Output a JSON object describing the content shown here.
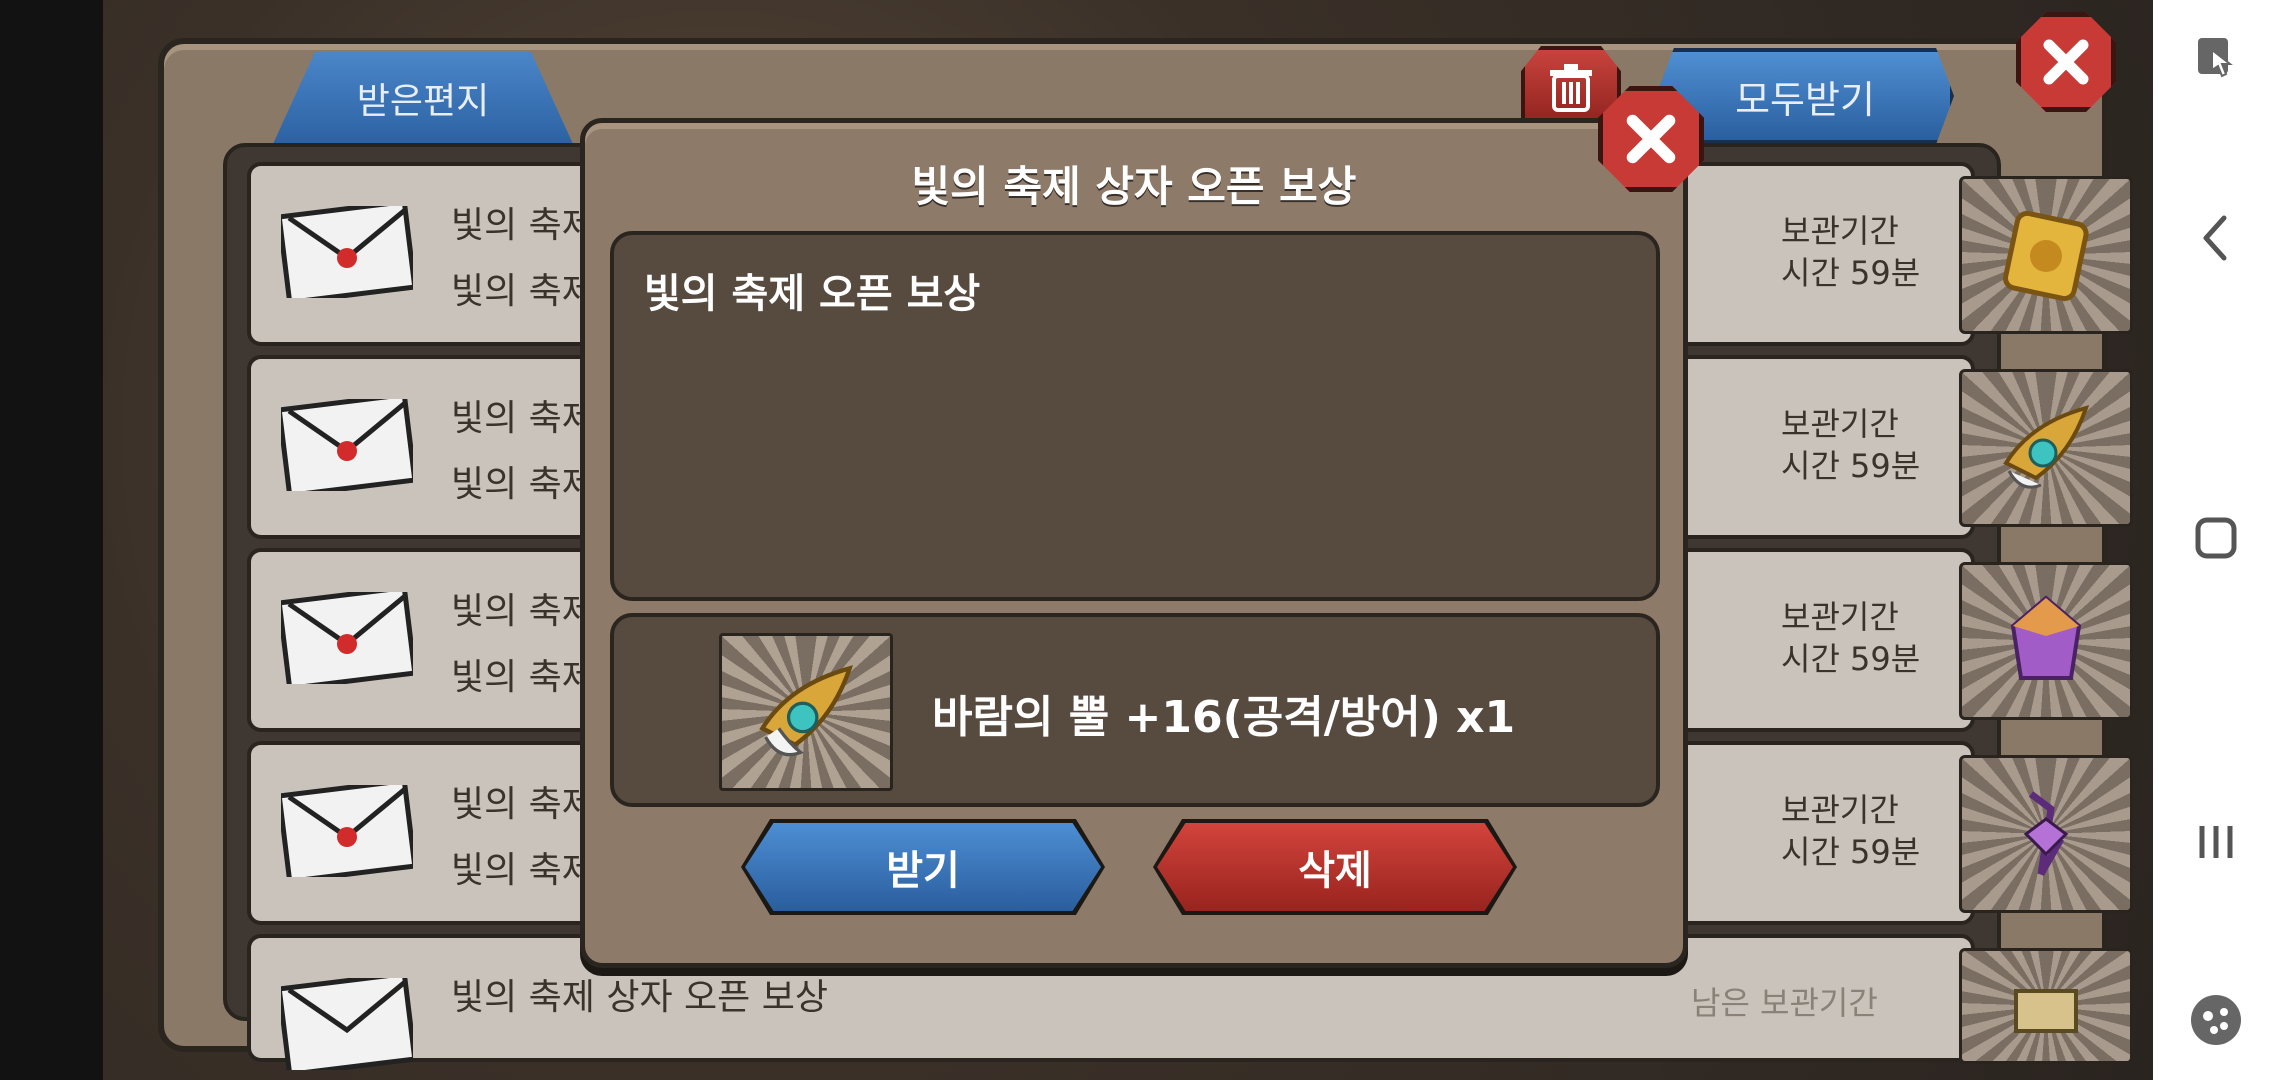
{
  "mailbox": {
    "tab_received": "받은편지",
    "receive_all_label": "모두받기",
    "rows": [
      {
        "title": "빛의 축제",
        "subtitle": "빛의 축제",
        "expiry_label": "보관기간",
        "expiry_time": "시간 59분",
        "item_icon": "golden-tablet"
      },
      {
        "title": "빛의 축제",
        "subtitle": "빛의 축제",
        "expiry_label": "보관기간",
        "expiry_time": "시간 59분",
        "item_icon": "wind-horn"
      },
      {
        "title": "빛의 축제",
        "subtitle": "빛의 축제",
        "expiry_label": "보관기간",
        "expiry_time": "시간 59분",
        "item_icon": "purple-crystal"
      },
      {
        "title": "빛의 축제",
        "subtitle": "빛의 축제",
        "expiry_label": "보관기간",
        "expiry_time": "시간 59분",
        "item_icon": "purple-amulet"
      },
      {
        "title": "빛의 축제 상자 오픈 보상",
        "subtitle": "",
        "expiry_label": "남은 보관기간",
        "expiry_time": "",
        "item_icon": "scroll"
      }
    ]
  },
  "dialog": {
    "title": "빛의 축제 상자 오픈 보상",
    "message": "빛의 축제 오픈 보상",
    "reward_text": "바람의 뿔 +16(공격/방어) x1",
    "receive_label": "받기",
    "delete_label": "삭제"
  },
  "colors": {
    "accent_blue": "#2c62a3",
    "accent_red": "#c73a36",
    "panel_brown": "#8d7a68"
  }
}
